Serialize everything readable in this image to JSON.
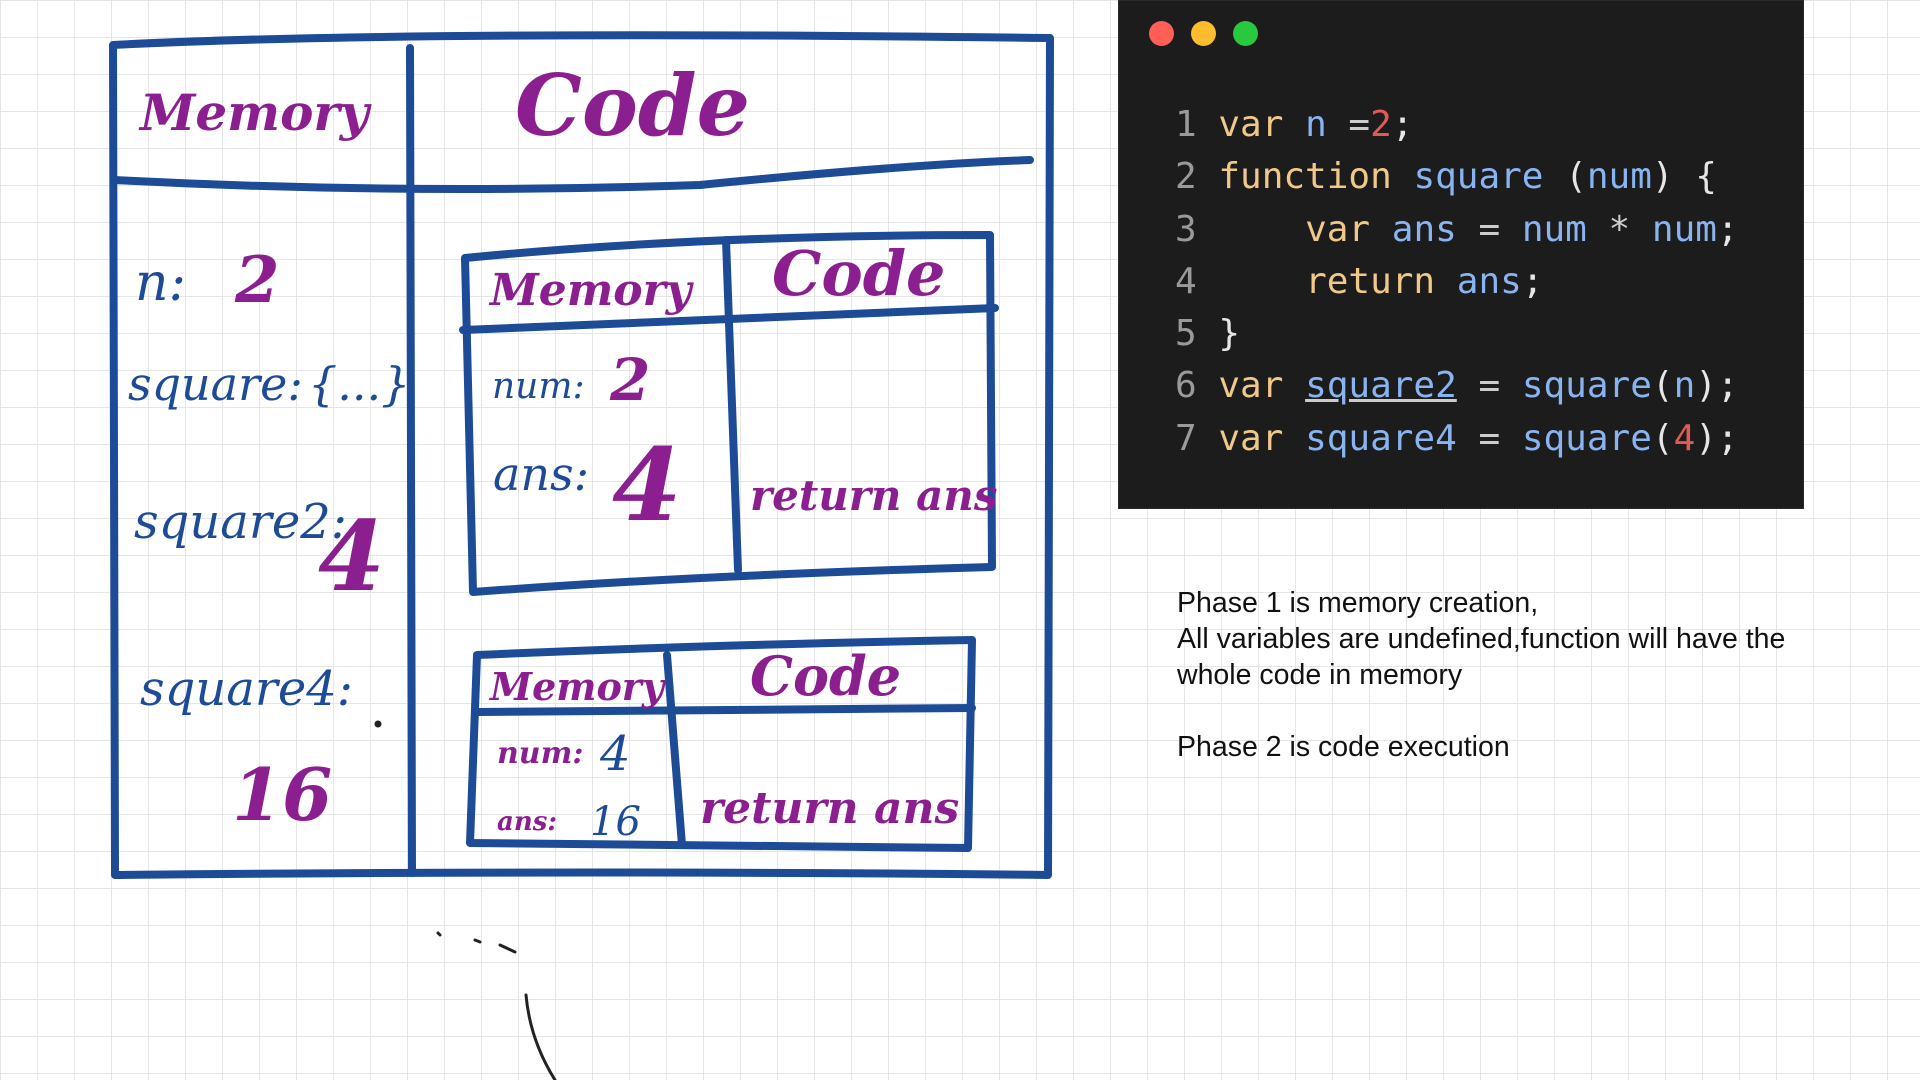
{
  "diagram": {
    "outer": {
      "memory_header": "Memory",
      "code_header": "Code",
      "entries": [
        {
          "key": "n:",
          "value": "2"
        },
        {
          "key": "square:",
          "value": "{...}"
        },
        {
          "key": "square2:",
          "value": "4"
        },
        {
          "key": "square4:",
          "value": "16"
        }
      ]
    },
    "context1": {
      "memory_header": "Memory",
      "code_header": "Code",
      "num_key": "num:",
      "num_value": "2",
      "ans_key": "ans:",
      "ans_value": "4",
      "code_text": "return ans"
    },
    "context2": {
      "memory_header": "Memory",
      "code_header": "Code",
      "num_key": "num:",
      "num_value": "4",
      "ans_key": "ans:",
      "ans_value": "16",
      "code_text": "return ans"
    }
  },
  "code_window": {
    "traffic_lights": [
      "#ff5f57",
      "#febc2e",
      "#28c840"
    ],
    "lines": [
      {
        "n": "1",
        "tokens": [
          [
            "kw",
            "var "
          ],
          [
            "id",
            "n "
          ],
          [
            "op",
            "="
          ],
          [
            "nm",
            "2"
          ],
          [
            "pn",
            ";"
          ]
        ]
      },
      {
        "n": "2",
        "tokens": [
          [
            "kw",
            "function "
          ],
          [
            "id",
            "square "
          ],
          [
            "pn",
            "("
          ],
          [
            "id",
            "num"
          ],
          [
            "pn",
            ") {"
          ]
        ]
      },
      {
        "n": "3",
        "tokens": [
          [
            "pn",
            "    "
          ],
          [
            "kw",
            "var "
          ],
          [
            "id",
            "ans "
          ],
          [
            "op",
            "= "
          ],
          [
            "id",
            "num "
          ],
          [
            "op",
            "* "
          ],
          [
            "id",
            "num"
          ],
          [
            "pn",
            ";"
          ]
        ]
      },
      {
        "n": "4",
        "tokens": [
          [
            "pn",
            "    "
          ],
          [
            "kw",
            "return "
          ],
          [
            "id",
            "ans"
          ],
          [
            "pn",
            ";"
          ]
        ]
      },
      {
        "n": "5",
        "tokens": [
          [
            "pn",
            "}"
          ]
        ]
      },
      {
        "n": "6",
        "tokens": [
          [
            "kw",
            "var "
          ],
          [
            "id ul",
            "square2"
          ],
          [
            "pn",
            " "
          ],
          [
            "op",
            "= "
          ],
          [
            "id",
            "square"
          ],
          [
            "pn",
            "("
          ],
          [
            "id",
            "n"
          ],
          [
            "pn",
            ");"
          ]
        ]
      },
      {
        "n": "7",
        "tokens": [
          [
            "kw",
            "var "
          ],
          [
            "id",
            "square4"
          ],
          [
            "pn",
            " "
          ],
          [
            "op",
            "= "
          ],
          [
            "id",
            "square"
          ],
          [
            "pn",
            "("
          ],
          [
            "nm",
            "4"
          ],
          [
            "pn",
            ");"
          ]
        ]
      }
    ]
  },
  "notes": {
    "phase1_line1": "Phase 1 is memory creation,",
    "phase1_line2": "All variables are undefined,function will have the",
    "phase1_line3": "whole code in memory",
    "phase2": "Phase 2 is code execution"
  }
}
